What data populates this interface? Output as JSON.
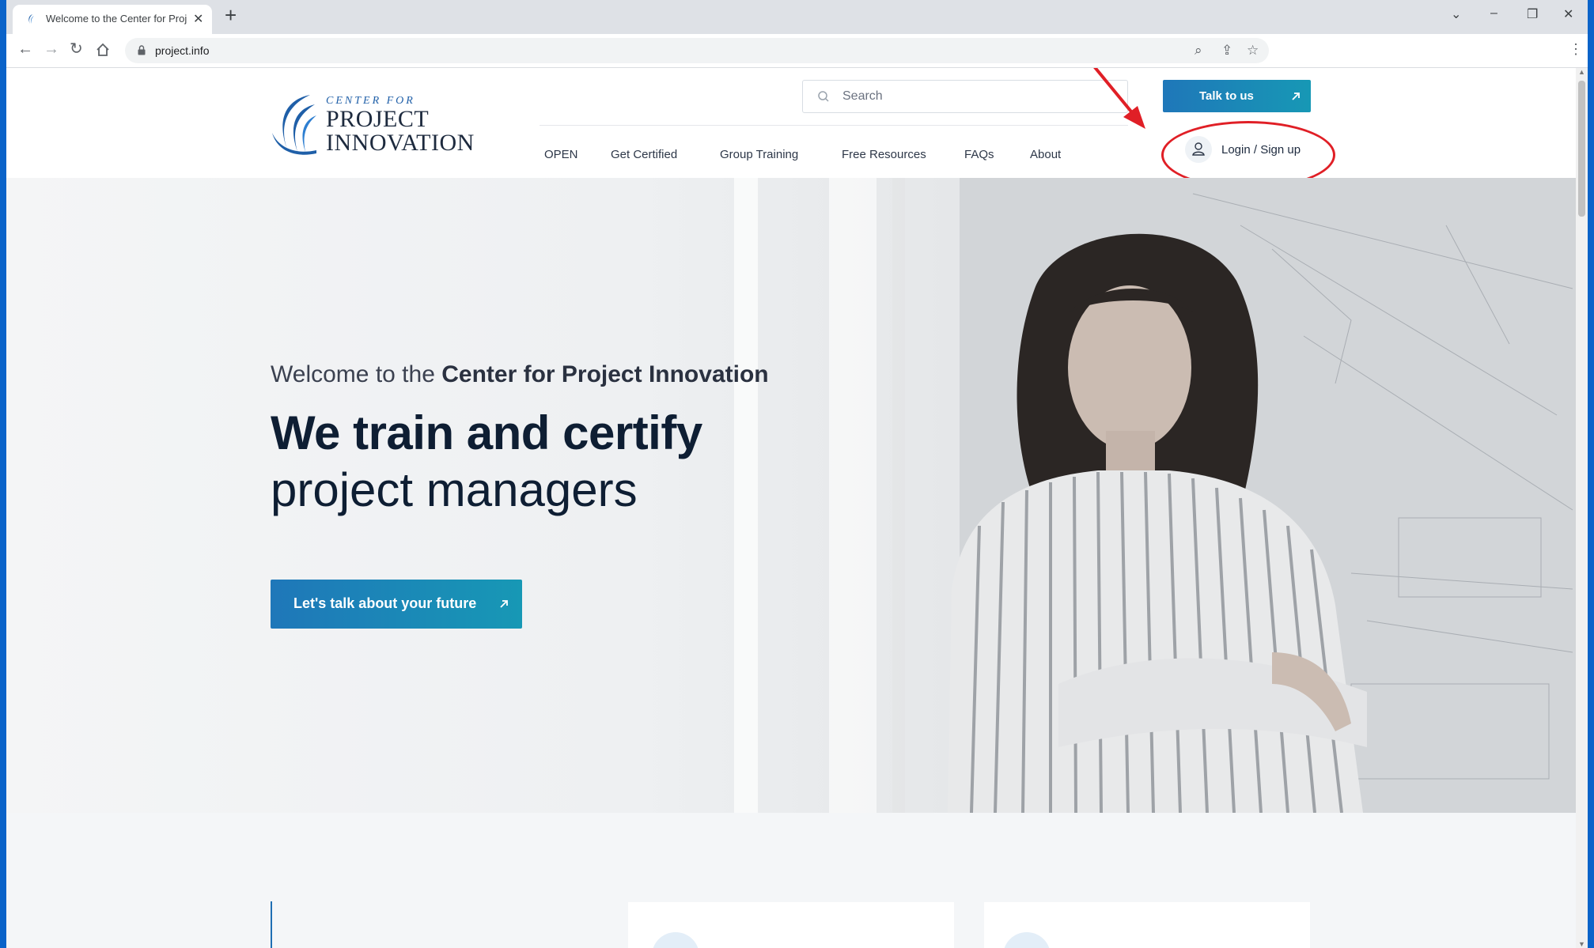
{
  "browser": {
    "tab_title": "Welcome to the Center for Proje",
    "url": "project.info",
    "new_tab_label": "+",
    "tab_close_label": "✕"
  },
  "site": {
    "logo": {
      "line1": "CENTER FOR",
      "line2": "PROJECT",
      "line3": "INNOVATION"
    },
    "search_placeholder": "Search",
    "talk_button": "Talk to us",
    "nav": [
      "OPEN",
      "Get Certified",
      "Group Training",
      "Free Resources",
      "FAQs",
      "About"
    ],
    "login_label": "Login / Sign up",
    "accent_color": "#1f77b9",
    "annotation_color": "#e01f26"
  },
  "hero": {
    "subtitle_prefix": "Welcome to the ",
    "subtitle_bold": "Center for Project Innovation",
    "title_bold": "We train and certify",
    "title_regular": "project managers",
    "cta_label": "Let's talk about your future"
  }
}
